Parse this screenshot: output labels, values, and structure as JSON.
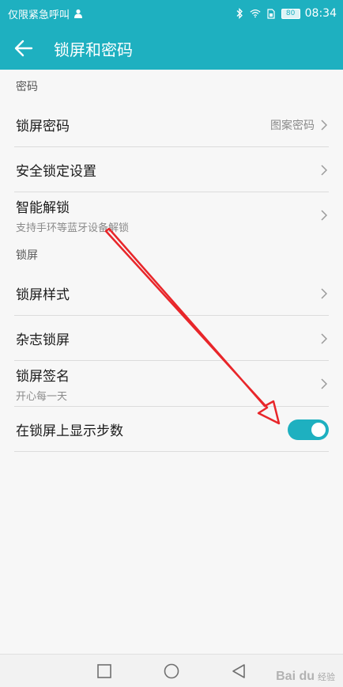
{
  "status_bar": {
    "left_text": "仅限紧急呼叫",
    "battery": "80",
    "time": "08:34"
  },
  "app_bar": {
    "title": "锁屏和密码"
  },
  "sections": {
    "password": {
      "header": "密码",
      "items": [
        {
          "title": "锁屏密码",
          "value": "图案密码"
        },
        {
          "title": "安全锁定设置"
        },
        {
          "title": "智能解锁",
          "subtitle": "支持手环等蓝牙设备解锁"
        }
      ]
    },
    "lockscreen": {
      "header": "锁屏",
      "items": [
        {
          "title": "锁屏样式"
        },
        {
          "title": "杂志锁屏"
        },
        {
          "title": "锁屏签名",
          "subtitle": "开心每一天"
        },
        {
          "title": "在锁屏上显示步数",
          "toggle_on": true
        }
      ]
    }
  },
  "watermark": {
    "logo": "Bai du",
    "text": "经验"
  },
  "colors": {
    "accent": "#1eb0c0",
    "annotation_arrow": "#e8262a"
  },
  "icons": {
    "back": "arrow-left-icon",
    "chevron": "chevron-right-icon",
    "nav_recent": "square-icon",
    "nav_home": "circle-icon",
    "nav_back": "triangle-icon"
  }
}
